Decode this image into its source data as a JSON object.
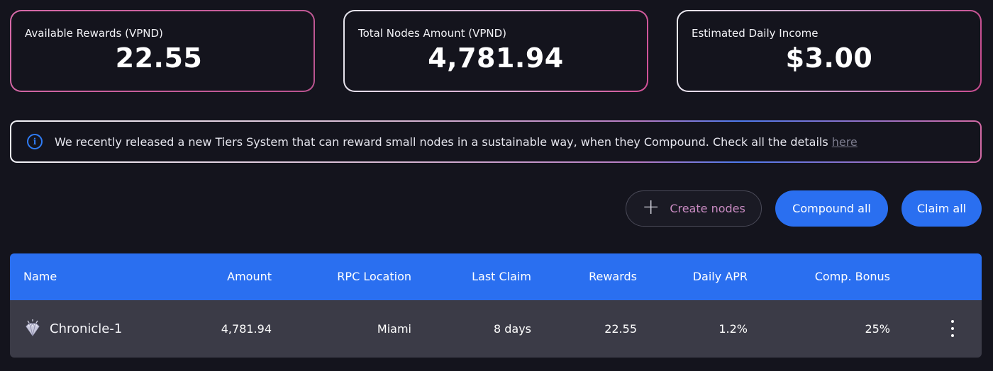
{
  "stats": [
    {
      "label": "Available Rewards (VPND)",
      "value": "22.55"
    },
    {
      "label": "Total Nodes Amount (VPND)",
      "value": "4,781.94"
    },
    {
      "label": "Estimated Daily Income",
      "value": "$3.00"
    }
  ],
  "notice": {
    "icon": "info-icon",
    "text": "We recently released a new Tiers System that can reward small nodes in a sustainable way, when they Compound. Check all the details",
    "link": "here"
  },
  "actions": {
    "create_label": "Create nodes",
    "compound_label": "Compound all",
    "claim_label": "Claim all"
  },
  "table": {
    "columns": [
      "Name",
      "Amount",
      "RPC Location",
      "Last Claim",
      "Rewards",
      "Daily APR",
      "Comp. Bonus"
    ],
    "rows": [
      {
        "icon": "diamond-icon",
        "name": "Chronicle-1",
        "amount": "4,781.94",
        "rpc_location": "Miami",
        "last_claim": "8 days",
        "rewards": "22.55",
        "daily_apr": "1.2%",
        "comp_bonus": "25%"
      }
    ]
  },
  "colors": {
    "background": "#14141d",
    "accent_blue": "#2a6ff0",
    "accent_pink": "#d76aa8",
    "row_bg": "#3b3b47"
  }
}
